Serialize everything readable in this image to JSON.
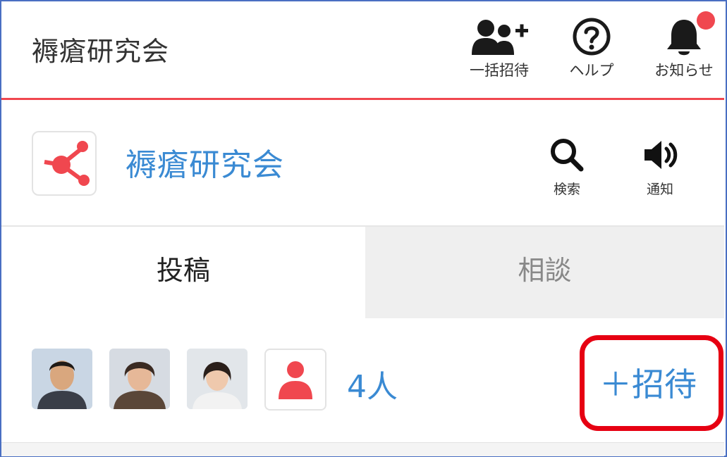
{
  "header": {
    "title": "褥瘡研究会",
    "bulk_invite_label": "一括招待",
    "help_label": "ヘルプ",
    "notice_label": "お知らせ",
    "notice_icon": "bell-icon",
    "help_icon": "question-circle-icon",
    "bulk_invite_icon": "users-plus-icon",
    "accent_color": "#f0474f"
  },
  "group": {
    "name": "褥瘡研究会",
    "logo_icon": "share-network-icon",
    "search_label": "検索",
    "notify_label": "通知",
    "name_color": "#3a8ad3"
  },
  "tabs": [
    {
      "label": "投稿",
      "active": true
    },
    {
      "label": "相談",
      "active": false
    }
  ],
  "members": {
    "count_label": "4人",
    "invite_label": "＋招待",
    "highlight_color": "#e60012"
  }
}
